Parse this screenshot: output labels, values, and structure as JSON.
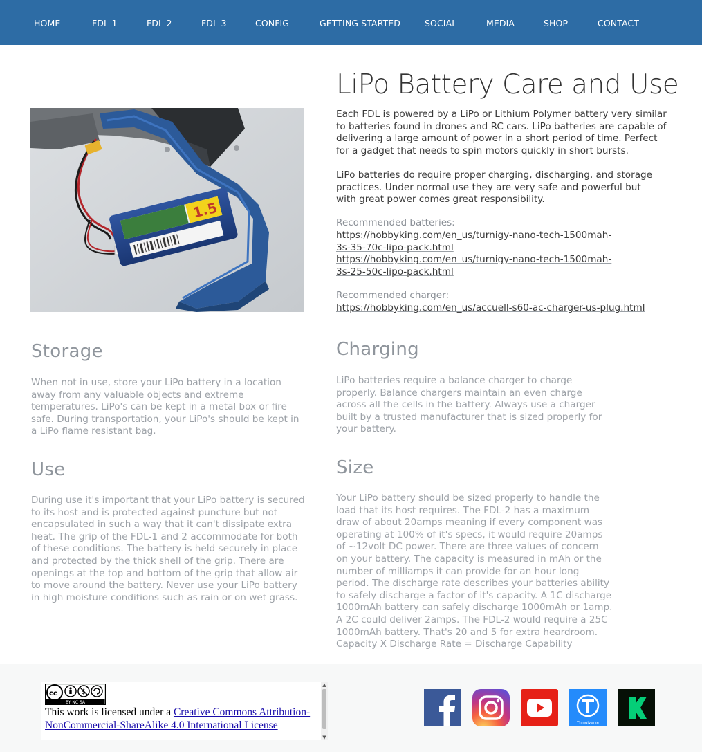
{
  "nav": {
    "items": [
      "HOME",
      "FDL-1",
      "FDL-2",
      "FDL-3",
      "CONFIG",
      "GETTING STARTED",
      "SOCIAL",
      "MEDIA",
      "SHOP",
      "CONTACT"
    ]
  },
  "hero": {
    "title": "LiPo Battery Care and Use",
    "intro": "Each FDL is powered by a LiPo or Lithium Polymer battery very similar to batteries found in drones and RC cars. LiPo batteries are capable of delivering a large amount of power in a short period of time. Perfect for a gadget that needs to spin motors quickly in short bursts.",
    "responsibility": "LiPo batteries do require proper charging, discharging, and storage practices. Under normal use they are very safe and powerful but with great power comes great responsibility.",
    "batteries_label": "Recommended batteries:",
    "battery_links": [
      "https://hobbyking.com/en_us/turnigy-nano-tech-1500mah-3s-35-70c-lipo-pack.html",
      "https://hobbyking.com/en_us/turnigy-nano-tech-1500mah-3s-25-50c-lipo-pack.html"
    ],
    "charger_label": "Recommended charger:",
    "charger_link": "https://hobbyking.com/en_us/accuell-s60-ac-charger-us-plug.html",
    "image_label": "1.5"
  },
  "sections": {
    "storage": {
      "heading": "Storage",
      "body": "When not in use, store your LiPo battery in a location away from any valuable objects and extreme temperatures. LiPo's can be kept in a metal box or fire safe. During transportation, your LiPo's should be kept in a LiPo flame resistant bag."
    },
    "charging": {
      "heading": "Charging",
      "body": "LiPo batteries require a balance charger to charge properly. Balance chargers maintain an even charge across all the cells in the battery. Always use a charger built by a trusted manufacturer that is sized properly for your battery."
    },
    "use": {
      "heading": "Use",
      "body": "During use it's important that your LiPo battery is secured to its host and is protected against puncture but not encapsulated in such a way that it can't dissipate extra heat. The grip of the FDL-1 and 2 accommodate for both of these conditions. The battery is held securely in place and protected by the thick shell of the grip. There are openings at the top and bottom of the grip that allow air to move around the battery. Never use your LiPo battery in high moisture conditions such as rain or on wet grass."
    },
    "size": {
      "heading": "Size",
      "body": "Your LiPo battery should be sized properly to handle the load that its host requires. The FDL-2 has a maximum draw of about 20amps meaning if every component was operating at 100% of it's specs, it would require 20amps of ~12volt DC power. There are three values of concern on your battery. The capacity is measured in mAh or the number of milliamps it can provide for an hour long period. The discharge rate describes your batteries ability to safely discharge a factor of it's capacity. A 1C discharge 1000mAh battery can safely discharge 1000mAh or 1amp. A 2C could deliver 2amps. The FDL-2 would require a 25C 1000mAh battery. That's 20 and 5 for extra heardroom. Capacity X Discharge Rate = Discharge Capability"
    }
  },
  "footer": {
    "license_prefix": "This work is licensed under a ",
    "license_link": "Creative Commons Attribution-NonCommercial-ShareAlike 4.0 International License",
    "cc_badge": {
      "cc": "cc",
      "labels": "BY  NC  SA"
    },
    "social": [
      {
        "name": "facebook-icon",
        "color": "#3b5998"
      },
      {
        "name": "instagram-icon",
        "color": "#c13584"
      },
      {
        "name": "youtube-icon",
        "color": "#e62117"
      },
      {
        "name": "thingiverse-icon",
        "color": "#248bfb",
        "caption": "Thingiverse"
      },
      {
        "name": "kickstarter-icon",
        "color": "#05ce78"
      }
    ]
  }
}
